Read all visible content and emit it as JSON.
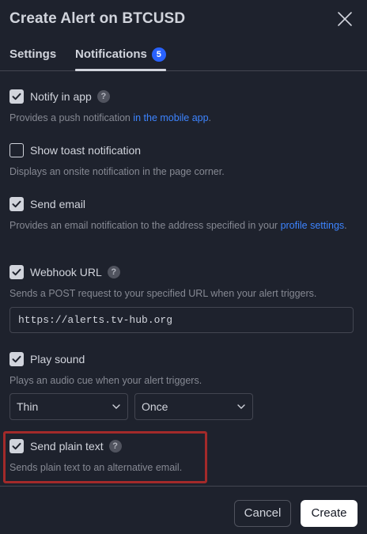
{
  "dialog": {
    "title": "Create Alert on BTCUSD",
    "close_icon": "close-icon"
  },
  "tabs": [
    {
      "label": "Settings",
      "active": false
    },
    {
      "label": "Notifications",
      "active": true,
      "badge": "5"
    }
  ],
  "options": {
    "notify_in_app": {
      "label": "Notify in app",
      "checked": true,
      "desc_text": "Provides a push notification ",
      "desc_link": "in the mobile app",
      "desc_suffix": "."
    },
    "show_toast": {
      "label": "Show toast notification",
      "checked": false,
      "desc": "Displays an onsite notification in the page corner."
    },
    "send_email": {
      "label": "Send email",
      "checked": true,
      "desc_text": "Provides an email notification to the address specified in your ",
      "desc_link": "profile settings",
      "desc_suffix": "."
    },
    "webhook": {
      "label": "Webhook URL",
      "checked": true,
      "desc": "Sends a POST request to your specified URL when your alert triggers.",
      "url_value": "https://alerts.tv-hub.org"
    },
    "play_sound": {
      "label": "Play sound",
      "checked": true,
      "desc": "Plays an audio cue when your alert triggers.",
      "sound_value": "Thin",
      "repeat_value": "Once"
    },
    "send_plain_text": {
      "label": "Send plain text",
      "checked": true,
      "desc": "Sends plain text to an alternative email."
    }
  },
  "help_icon_glyph": "?",
  "footer": {
    "cancel_label": "Cancel",
    "create_label": "Create"
  },
  "colors": {
    "background": "#1e222d",
    "text": "#d1d4dc",
    "muted": "#868993",
    "link": "#3d84ff",
    "badge": "#2962ff",
    "highlight": "#a32a2a"
  }
}
